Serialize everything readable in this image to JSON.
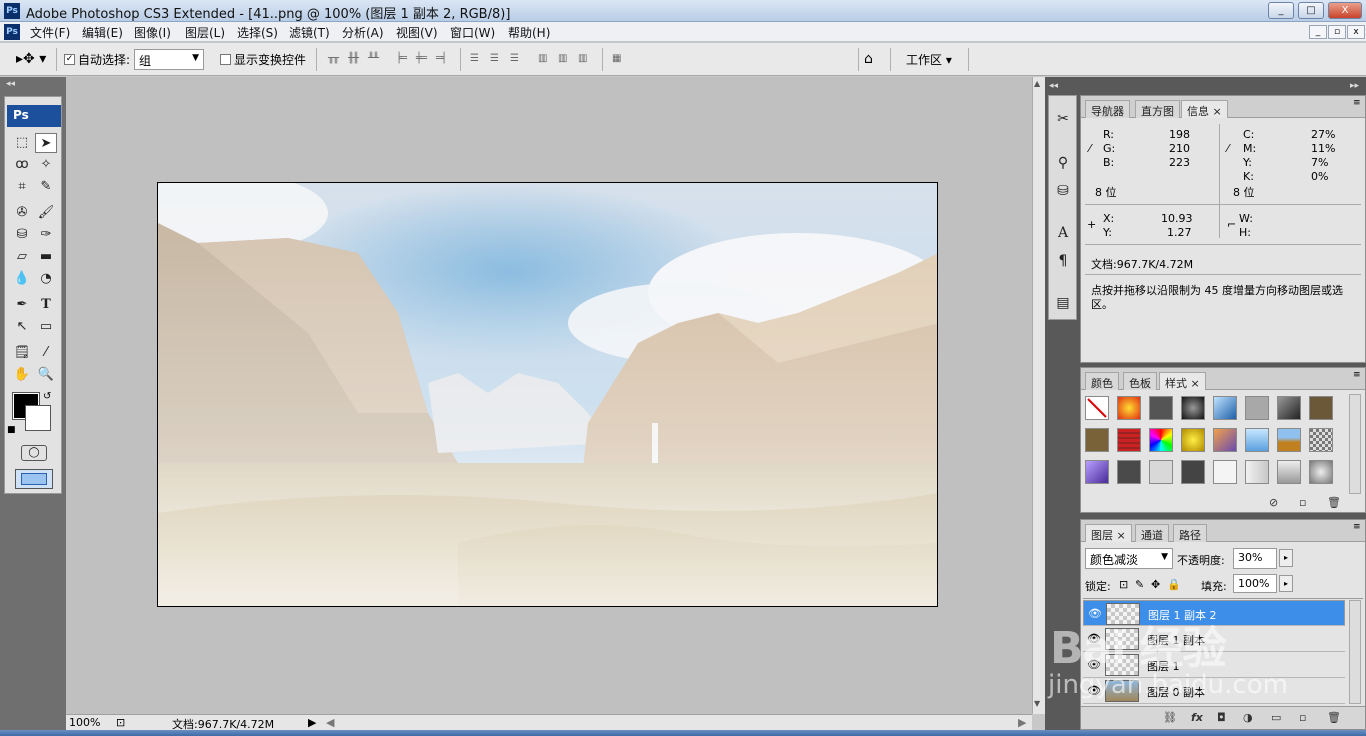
{
  "window": {
    "title": "Adobe Photoshop CS3 Extended - [41..png @ 100% (图层 1 副本 2, RGB/8)]",
    "minimize": "_",
    "maximize": "□",
    "close": "X"
  },
  "menu": {
    "items": [
      "文件(F)",
      "编辑(E)",
      "图像(I)",
      "图层(L)",
      "选择(S)",
      "滤镜(T)",
      "分析(A)",
      "视图(V)",
      "窗口(W)",
      "帮助(H)"
    ]
  },
  "options": {
    "auto_select_label": "自动选择:",
    "auto_select_value": "组",
    "show_transform_label": "显示变换控件",
    "workspace_label": "工作区"
  },
  "toolbox": {
    "header": "Ps"
  },
  "status": {
    "zoom": "100%",
    "doc": "文档:967.7K/4.72M"
  },
  "info_panel": {
    "tabs": [
      "导航器",
      "直方图",
      "信息"
    ],
    "rgb_labels": [
      "R:",
      "G:",
      "B:"
    ],
    "rgb_values": [
      "198",
      "210",
      "223"
    ],
    "cmyk_labels": [
      "C:",
      "M:",
      "Y:",
      "K:"
    ],
    "cmyk_values": [
      "27%",
      "11%",
      "7%",
      "0%"
    ],
    "bits_left": "8 位",
    "bits_right": "8 位",
    "x_label": "X:",
    "y_label": "Y:",
    "x_value": "10.93",
    "y_value": "1.27",
    "w_label": "W:",
    "h_label": "H:",
    "doc": "文档:967.7K/4.72M",
    "hint": "点按并拖移以沿限制为 45 度增量方向移动图层或选区。"
  },
  "styles_panel": {
    "tabs": [
      "颜色",
      "色板",
      "样式"
    ]
  },
  "layers_panel": {
    "tabs": [
      "图层",
      "通道",
      "路径"
    ],
    "blend_mode": "颜色减淡",
    "opacity_label": "不透明度:",
    "opacity_value": "30%",
    "lock_label": "锁定:",
    "fill_label": "填充:",
    "fill_value": "100%",
    "layers": [
      {
        "name": "图层 1 副本 2",
        "selected": true
      },
      {
        "name": "图层 1 副本",
        "selected": false
      },
      {
        "name": "图层 1",
        "selected": false
      },
      {
        "name": "图层 0 副本",
        "selected": false
      }
    ]
  },
  "watermark": {
    "logo": "Bai 经验",
    "url": "jingyan.baidu.com"
  }
}
